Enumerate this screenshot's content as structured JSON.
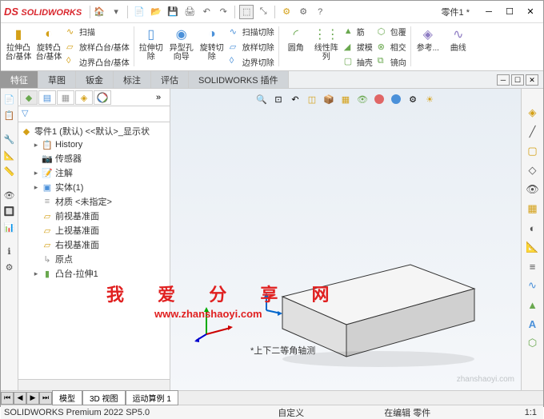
{
  "app": {
    "logo_prefix": "DS",
    "logo": "SOLIDWORKS",
    "doc_name": "零件1 *"
  },
  "ribbon": {
    "boss": {
      "label": "拉伸凸\n台/基体"
    },
    "revolve": {
      "label": "旋转凸\n台/基体"
    },
    "sweep": {
      "label": "扫描"
    },
    "loft": {
      "label": "放样凸台/基体"
    },
    "boundary": {
      "label": "边界凸台/基体"
    },
    "cut": {
      "label": "拉伸切\n除"
    },
    "hole": {
      "label": "异型孔向导"
    },
    "revcut": {
      "label": "旋转切\n除"
    },
    "sweepcut": {
      "label": "扫描切除"
    },
    "loftcut": {
      "label": "放样切除"
    },
    "boundarycut": {
      "label": "边界切除"
    },
    "fillet": {
      "label": "圆角"
    },
    "pattern": {
      "label": "线性阵列"
    },
    "rib": {
      "label": "筋"
    },
    "draft": {
      "label": "拔模"
    },
    "shell": {
      "label": "抽壳"
    },
    "wrap": {
      "label": "包覆"
    },
    "intersect": {
      "label": "相交"
    },
    "mirror": {
      "label": "镜向"
    },
    "ref": {
      "label": "参考..."
    },
    "curve": {
      "label": "曲线"
    }
  },
  "tabs": {
    "t1": "特征",
    "t2": "草图",
    "t3": "钣金",
    "t4": "标注",
    "t5": "评估",
    "t6": "SOLIDWORKS 插件"
  },
  "tree": {
    "root": "零件1 (默认) <<默认>_显示状",
    "history": "History",
    "sensors": "传感器",
    "annotations": "注解",
    "solid": "实体(1)",
    "material": "材质 <未指定>",
    "front": "前视基准面",
    "top": "上视基准面",
    "right": "右视基准面",
    "origin": "原点",
    "extrude": "凸台-拉伸1"
  },
  "watermark": {
    "text": "我 爱 分 享 网",
    "url": "www.zhanshaoyi.com",
    "corner": "zhanshaoyi.com"
  },
  "view": {
    "label": "*上下二等角轴测",
    "zoom": "1:1"
  },
  "bottom_tabs": {
    "t1": "模型",
    "t2": "3D 视图",
    "t3": "运动算例 1"
  },
  "status": {
    "version": "SOLIDWORKS Premium 2022 SP5.0",
    "custom": "自定义",
    "editing": "在编辑 零件"
  }
}
